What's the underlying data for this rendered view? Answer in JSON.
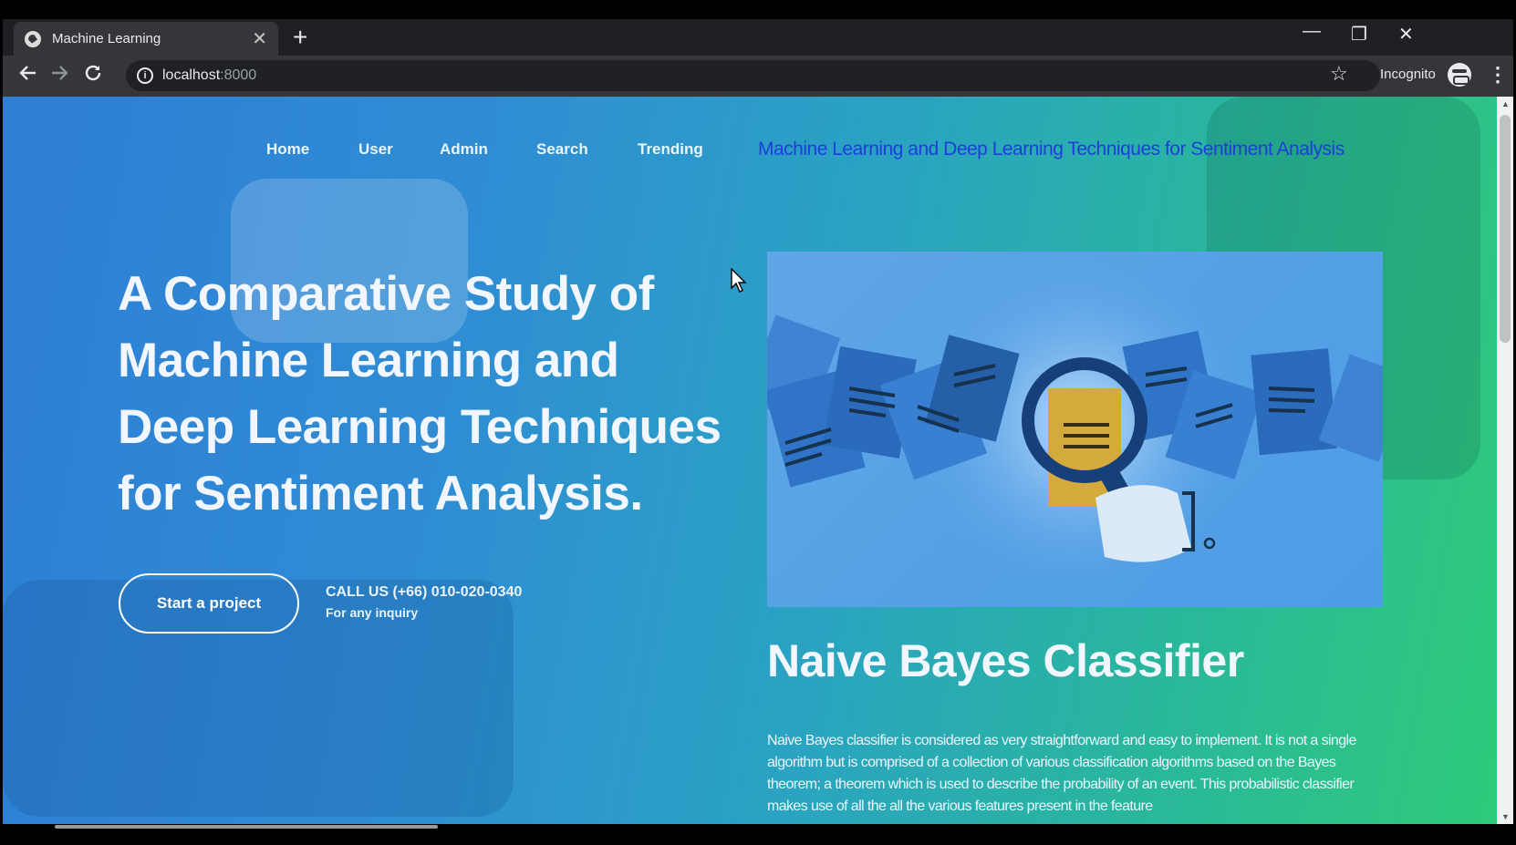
{
  "browser": {
    "tab_title": "Machine Learning",
    "tab_close": "✕",
    "new_tab": "+",
    "url_host": "localhost",
    "url_port": ":8000",
    "incognito_label": "Incognito",
    "window_controls": {
      "minimize": "—",
      "restore": "❐",
      "close": "✕"
    }
  },
  "nav": {
    "items": [
      "Home",
      "User",
      "Admin",
      "Search",
      "Trending"
    ],
    "brand": "Machine Learning and Deep Learning Techniques for Sentiment Analysis"
  },
  "hero": {
    "title": "A Comparative Study of Machine Learning and Deep Learning Techniques for Sentiment Analysis.",
    "cta": "Start a project",
    "call": "CALL US (+66) 010-020-0340",
    "inquiry": "For any inquiry"
  },
  "section": {
    "title": "Naive Bayes Classifier",
    "body": "Naive Bayes classifier is considered as very straightforward and easy to implement. It is not a single algorithm but is comprised of a collection of various classification algorithms based on the Bayes theorem; a theorem which is used to describe the probability of an event. This probabilistic classifier makes use of all the all the various features present in the feature"
  },
  "icons": {
    "back": "arrow-left-icon",
    "forward": "arrow-right-icon",
    "reload": "reload-icon",
    "info": "info-icon",
    "bookmark": "star-icon",
    "menu": "kebab-menu-icon",
    "incognito": "incognito-icon",
    "illustration": "document-search-illustration"
  }
}
